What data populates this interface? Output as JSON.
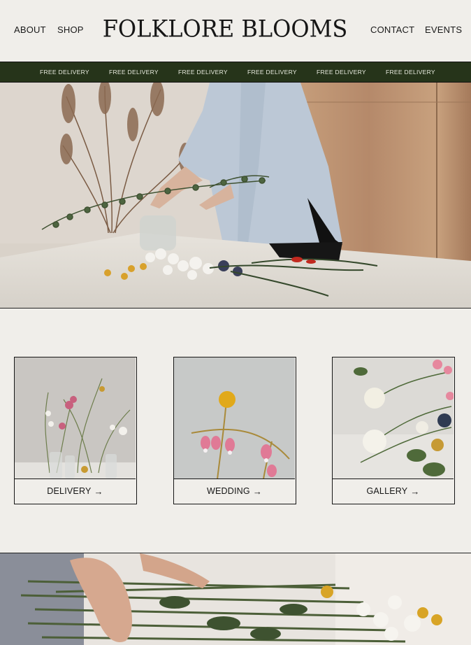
{
  "header": {
    "nav_left": [
      "ABOUT",
      "SHOP"
    ],
    "brand": "FOLKLORE BLOOMS",
    "nav_right": [
      "CONTACT",
      "EVENTS"
    ]
  },
  "banner": {
    "items": [
      "FREE DELIVERY",
      "FREE DELIVERY",
      "FREE DELIVERY",
      "FREE DELIVERY",
      "FREE DELIVERY",
      "FREE DELIVERY"
    ]
  },
  "cards": [
    {
      "label": "DELIVERY",
      "arrow": "→",
      "photo": "flowers-in-vases-photo"
    },
    {
      "label": "WEDDING",
      "arrow": "→",
      "photo": "craspedia-bleeding-heart-photo"
    },
    {
      "label": "GALLERY",
      "arrow": "→",
      "photo": "white-ranunculus-photo"
    }
  ],
  "colors": {
    "background": "#f0eeea",
    "banner": "#26341a",
    "text": "#161616"
  }
}
